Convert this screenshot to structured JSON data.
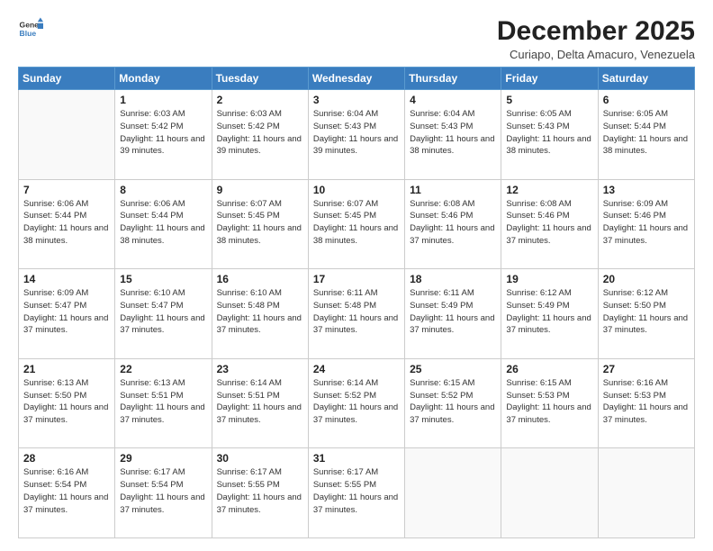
{
  "header": {
    "logo_general": "General",
    "logo_blue": "Blue",
    "month_title": "December 2025",
    "subtitle": "Curiapo, Delta Amacuro, Venezuela"
  },
  "weekdays": [
    "Sunday",
    "Monday",
    "Tuesday",
    "Wednesday",
    "Thursday",
    "Friday",
    "Saturday"
  ],
  "weeks": [
    [
      {
        "day": "",
        "sunrise": "",
        "sunset": "",
        "daylight": ""
      },
      {
        "day": "1",
        "sunrise": "6:03 AM",
        "sunset": "5:42 PM",
        "daylight": "11 hours and 39 minutes."
      },
      {
        "day": "2",
        "sunrise": "6:03 AM",
        "sunset": "5:42 PM",
        "daylight": "11 hours and 39 minutes."
      },
      {
        "day": "3",
        "sunrise": "6:04 AM",
        "sunset": "5:43 PM",
        "daylight": "11 hours and 39 minutes."
      },
      {
        "day": "4",
        "sunrise": "6:04 AM",
        "sunset": "5:43 PM",
        "daylight": "11 hours and 38 minutes."
      },
      {
        "day": "5",
        "sunrise": "6:05 AM",
        "sunset": "5:43 PM",
        "daylight": "11 hours and 38 minutes."
      },
      {
        "day": "6",
        "sunrise": "6:05 AM",
        "sunset": "5:44 PM",
        "daylight": "11 hours and 38 minutes."
      }
    ],
    [
      {
        "day": "7",
        "sunrise": "6:06 AM",
        "sunset": "5:44 PM",
        "daylight": "11 hours and 38 minutes."
      },
      {
        "day": "8",
        "sunrise": "6:06 AM",
        "sunset": "5:44 PM",
        "daylight": "11 hours and 38 minutes."
      },
      {
        "day": "9",
        "sunrise": "6:07 AM",
        "sunset": "5:45 PM",
        "daylight": "11 hours and 38 minutes."
      },
      {
        "day": "10",
        "sunrise": "6:07 AM",
        "sunset": "5:45 PM",
        "daylight": "11 hours and 38 minutes."
      },
      {
        "day": "11",
        "sunrise": "6:08 AM",
        "sunset": "5:46 PM",
        "daylight": "11 hours and 37 minutes."
      },
      {
        "day": "12",
        "sunrise": "6:08 AM",
        "sunset": "5:46 PM",
        "daylight": "11 hours and 37 minutes."
      },
      {
        "day": "13",
        "sunrise": "6:09 AM",
        "sunset": "5:46 PM",
        "daylight": "11 hours and 37 minutes."
      }
    ],
    [
      {
        "day": "14",
        "sunrise": "6:09 AM",
        "sunset": "5:47 PM",
        "daylight": "11 hours and 37 minutes."
      },
      {
        "day": "15",
        "sunrise": "6:10 AM",
        "sunset": "5:47 PM",
        "daylight": "11 hours and 37 minutes."
      },
      {
        "day": "16",
        "sunrise": "6:10 AM",
        "sunset": "5:48 PM",
        "daylight": "11 hours and 37 minutes."
      },
      {
        "day": "17",
        "sunrise": "6:11 AM",
        "sunset": "5:48 PM",
        "daylight": "11 hours and 37 minutes."
      },
      {
        "day": "18",
        "sunrise": "6:11 AM",
        "sunset": "5:49 PM",
        "daylight": "11 hours and 37 minutes."
      },
      {
        "day": "19",
        "sunrise": "6:12 AM",
        "sunset": "5:49 PM",
        "daylight": "11 hours and 37 minutes."
      },
      {
        "day": "20",
        "sunrise": "6:12 AM",
        "sunset": "5:50 PM",
        "daylight": "11 hours and 37 minutes."
      }
    ],
    [
      {
        "day": "21",
        "sunrise": "6:13 AM",
        "sunset": "5:50 PM",
        "daylight": "11 hours and 37 minutes."
      },
      {
        "day": "22",
        "sunrise": "6:13 AM",
        "sunset": "5:51 PM",
        "daylight": "11 hours and 37 minutes."
      },
      {
        "day": "23",
        "sunrise": "6:14 AM",
        "sunset": "5:51 PM",
        "daylight": "11 hours and 37 minutes."
      },
      {
        "day": "24",
        "sunrise": "6:14 AM",
        "sunset": "5:52 PM",
        "daylight": "11 hours and 37 minutes."
      },
      {
        "day": "25",
        "sunrise": "6:15 AM",
        "sunset": "5:52 PM",
        "daylight": "11 hours and 37 minutes."
      },
      {
        "day": "26",
        "sunrise": "6:15 AM",
        "sunset": "5:53 PM",
        "daylight": "11 hours and 37 minutes."
      },
      {
        "day": "27",
        "sunrise": "6:16 AM",
        "sunset": "5:53 PM",
        "daylight": "11 hours and 37 minutes."
      }
    ],
    [
      {
        "day": "28",
        "sunrise": "6:16 AM",
        "sunset": "5:54 PM",
        "daylight": "11 hours and 37 minutes."
      },
      {
        "day": "29",
        "sunrise": "6:17 AM",
        "sunset": "5:54 PM",
        "daylight": "11 hours and 37 minutes."
      },
      {
        "day": "30",
        "sunrise": "6:17 AM",
        "sunset": "5:55 PM",
        "daylight": "11 hours and 37 minutes."
      },
      {
        "day": "31",
        "sunrise": "6:17 AM",
        "sunset": "5:55 PM",
        "daylight": "11 hours and 37 minutes."
      },
      {
        "day": "",
        "sunrise": "",
        "sunset": "",
        "daylight": ""
      },
      {
        "day": "",
        "sunrise": "",
        "sunset": "",
        "daylight": ""
      },
      {
        "day": "",
        "sunrise": "",
        "sunset": "",
        "daylight": ""
      }
    ]
  ]
}
